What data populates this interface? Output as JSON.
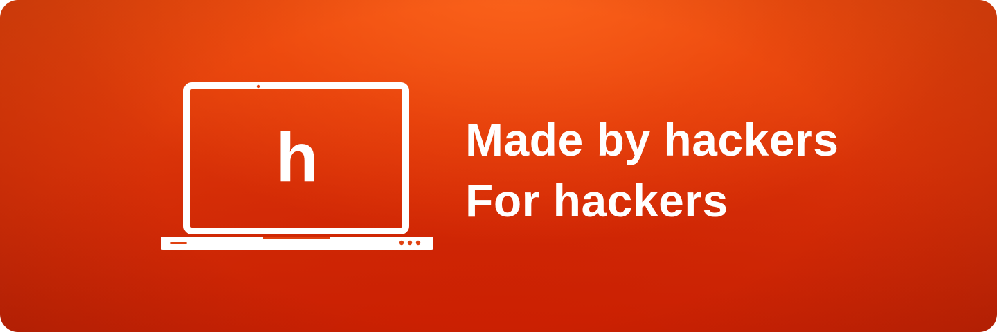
{
  "banner": {
    "logo_letter": "h",
    "line1": "Made by hackers",
    "line2": "For hackers"
  },
  "colors": {
    "background_top": "#f05a14",
    "background_bottom": "#c62406",
    "foreground": "#ffffff"
  },
  "icons": {
    "laptop": "laptop-icon"
  }
}
